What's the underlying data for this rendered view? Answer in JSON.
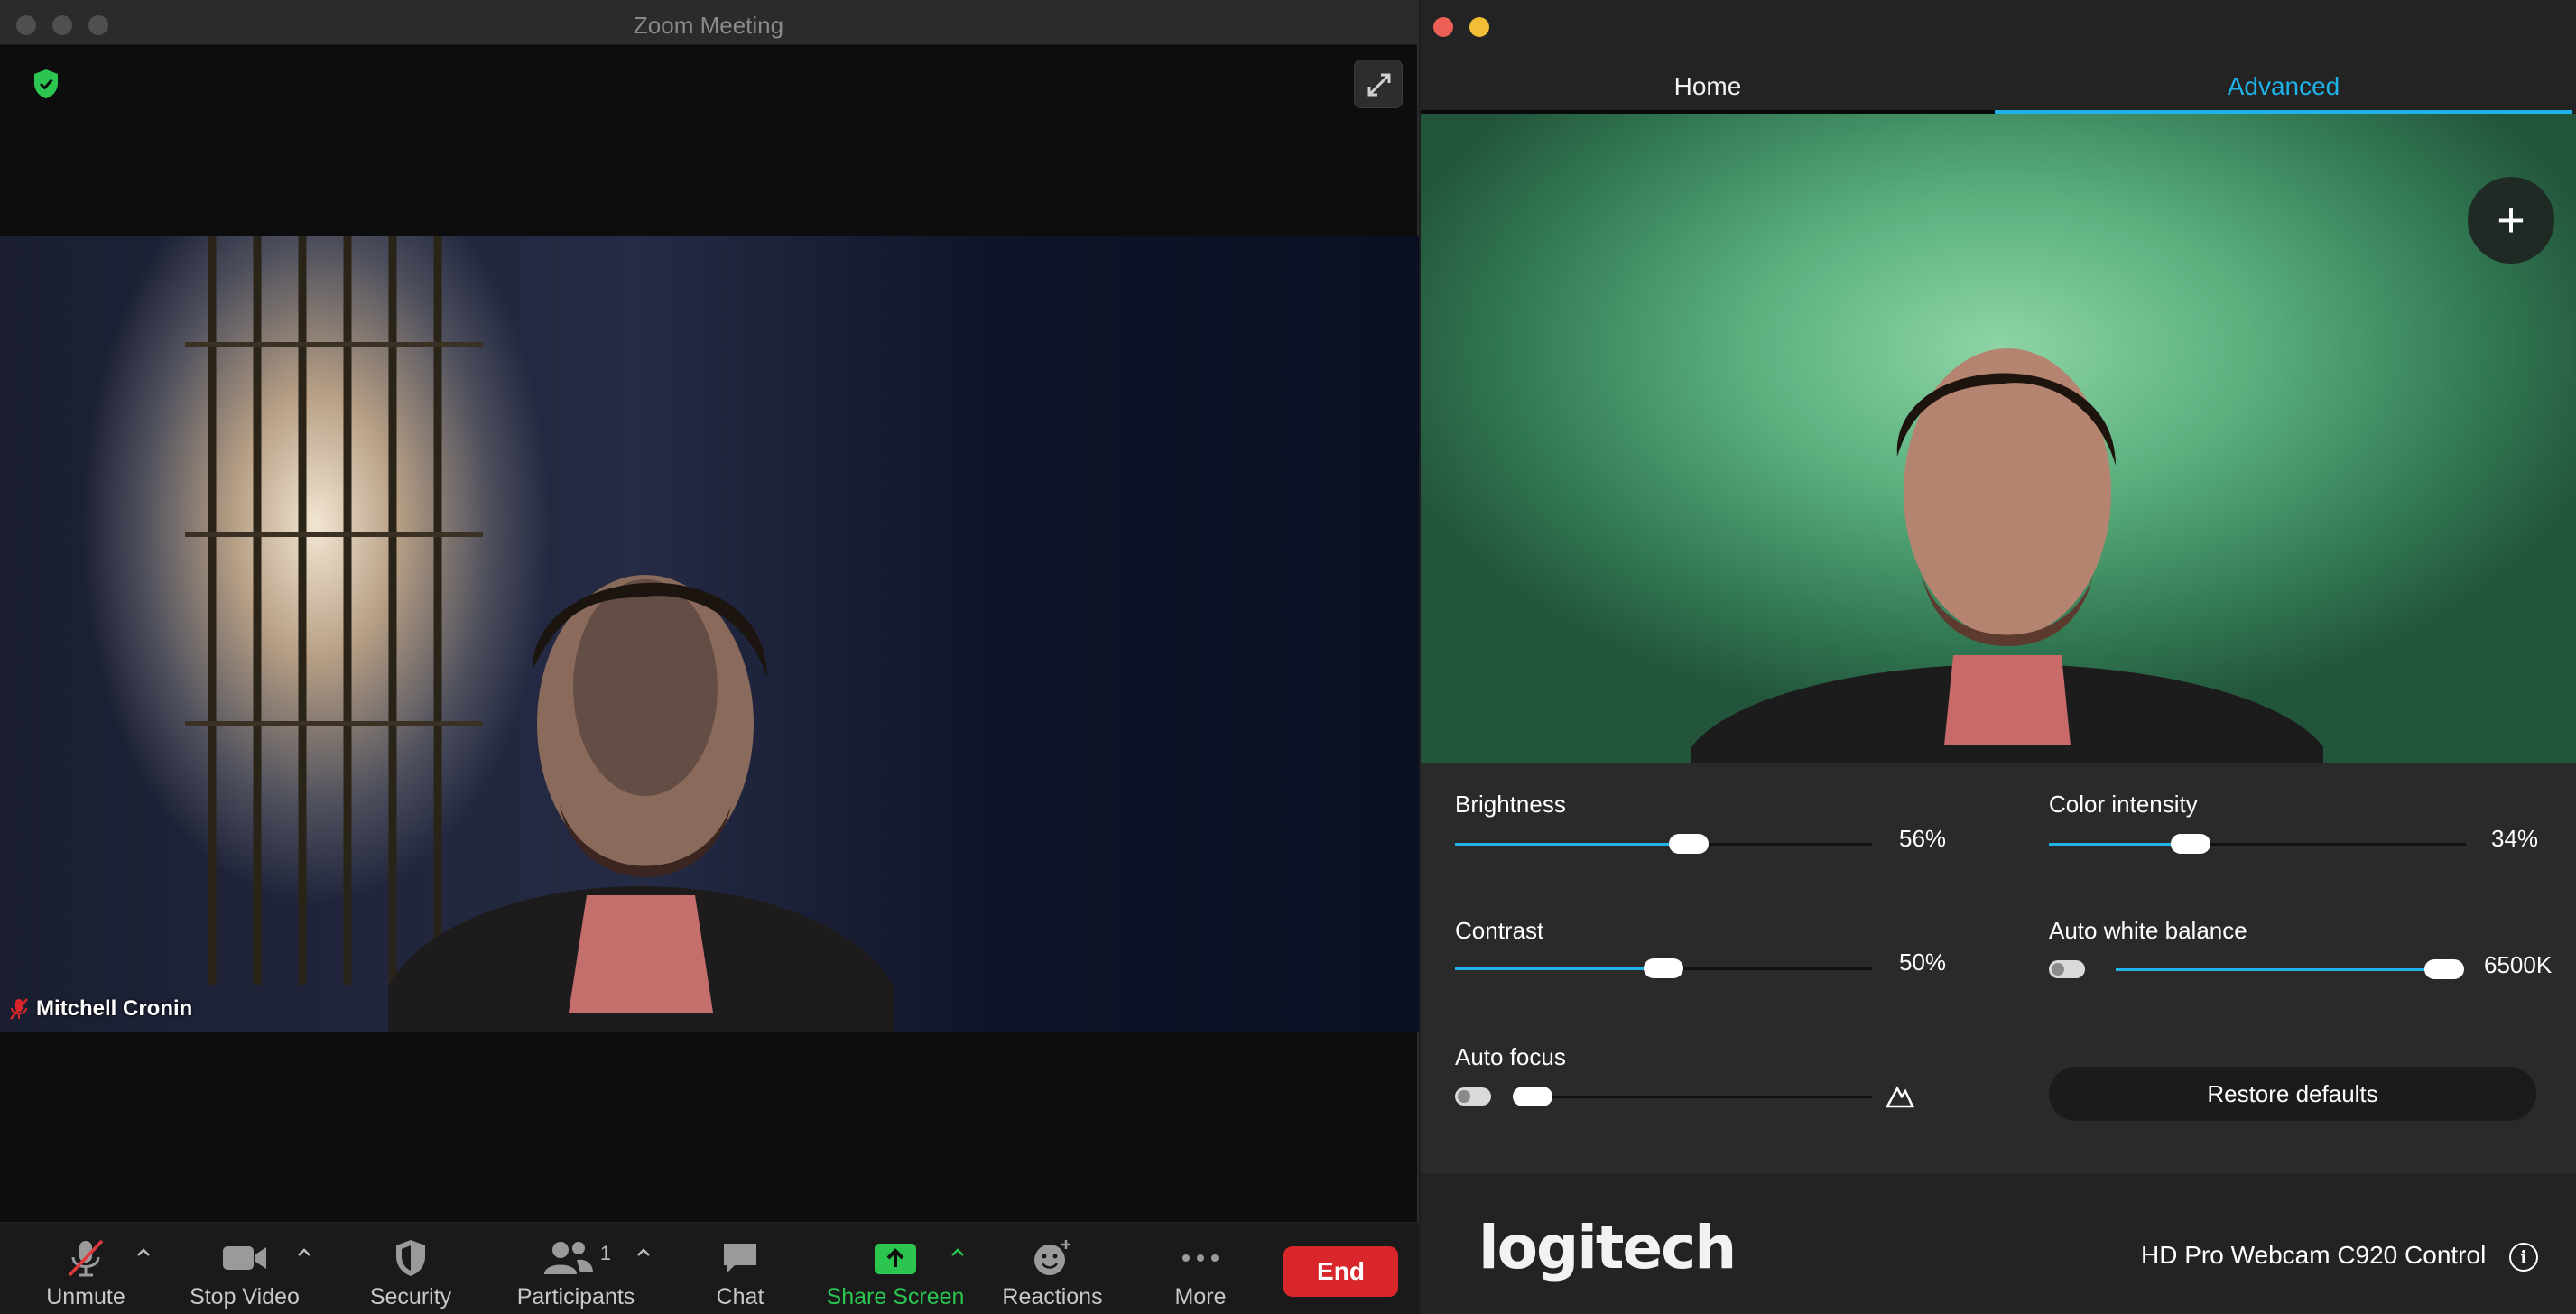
{
  "zoom": {
    "window_title": "Zoom Meeting",
    "participant_name": "Mitchell Cronin",
    "toolbar": {
      "unmute": "Unmute",
      "stop_video": "Stop Video",
      "security": "Security",
      "participants": "Participants",
      "participants_count": "1",
      "chat": "Chat",
      "share_screen": "Share Screen",
      "reactions": "Reactions",
      "more": "More",
      "end": "End"
    },
    "colors": {
      "share_green": "#2bc550",
      "end_red": "#d8262b",
      "shield_green": "#2bc550"
    }
  },
  "logitech": {
    "tabs": {
      "home": "Home",
      "advanced": "Advanced"
    },
    "active_tab": "Advanced",
    "brightness": {
      "label": "Brightness",
      "value": 56,
      "display": "56%"
    },
    "contrast": {
      "label": "Contrast",
      "value": 50,
      "display": "50%"
    },
    "auto_focus": {
      "label": "Auto focus",
      "enabled": false,
      "value": 5
    },
    "color_intensity": {
      "label": "Color intensity",
      "value": 34,
      "display": "34%"
    },
    "auto_white_balance": {
      "label": "Auto white balance",
      "enabled": false,
      "value": 100,
      "display": "6500K"
    },
    "restore_defaults": "Restore defaults",
    "brand": "logitech",
    "device_name": "HD Pro Webcam C920 Control",
    "colors": {
      "accent": "#1fb3ea"
    }
  }
}
